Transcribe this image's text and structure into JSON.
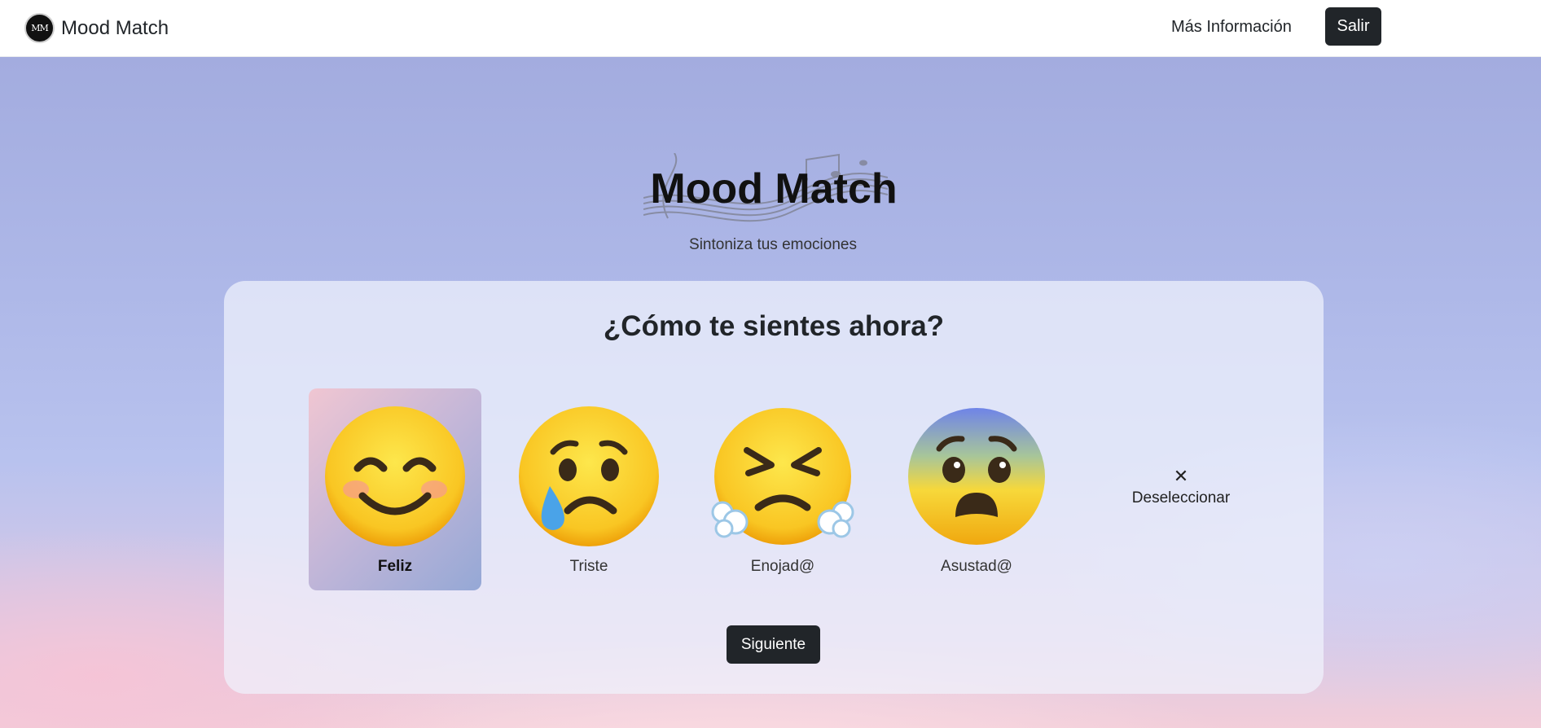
{
  "navbar": {
    "logo_text": "MM",
    "brand_name": "Mood Match",
    "more_info_link": "Más Información",
    "logout_button": "Salir"
  },
  "hero": {
    "title": "Mood Match",
    "subtitle": "Sintoniza tus emociones"
  },
  "card": {
    "question": "¿Cómo te sientes ahora?",
    "moods": [
      {
        "label": "Feliz",
        "icon": "smiling-face-icon",
        "selected": true
      },
      {
        "label": "Triste",
        "icon": "sad-tear-face-icon",
        "selected": false
      },
      {
        "label": "Enojad@",
        "icon": "steam-nose-face-icon",
        "selected": false
      },
      {
        "label": "Asustad@",
        "icon": "fearful-face-icon",
        "selected": false
      }
    ],
    "deselect_icon": "✕",
    "deselect_label": "Deseleccionar",
    "next_button": "Siguiente"
  },
  "colors": {
    "dark_button": "#212529",
    "selected_gradient_start": "#f0c6d2",
    "selected_gradient_end": "#95a8d6"
  }
}
